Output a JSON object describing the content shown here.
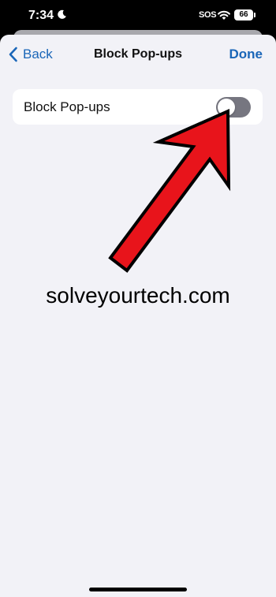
{
  "status_bar": {
    "time": "7:34",
    "sos": "SOS",
    "battery": "66"
  },
  "nav": {
    "back_label": "Back",
    "title": "Block Pop-ups",
    "done_label": "Done"
  },
  "settings": {
    "block_popups_label": "Block Pop-ups",
    "block_popups_enabled": false
  },
  "watermark": "solveyourtech.com",
  "icons": [
    "moon-icon",
    "wifi-icon",
    "battery-icon",
    "chevron-left-icon"
  ],
  "colors": {
    "accent": "#1a66b8",
    "background": "#f2f2f7",
    "toggle_off": "#767680",
    "arrow": "#e8141b"
  }
}
